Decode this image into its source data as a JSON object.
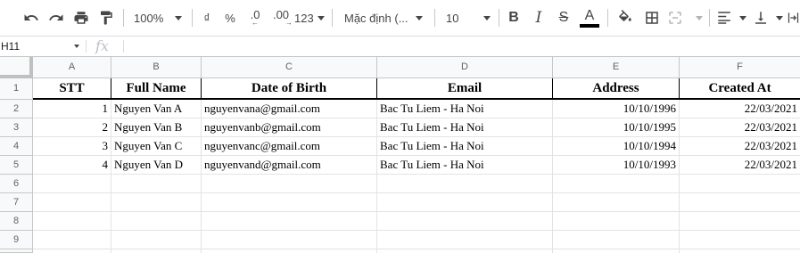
{
  "toolbar": {
    "zoom": "100%",
    "currency_symbol": "₫",
    "percent_symbol": "%",
    "decrease_decimal": ".0",
    "increase_decimal": ".00",
    "number_format": "123",
    "font_name": "Mặc định (...",
    "font_size": "10",
    "bold": "B",
    "italic": "I",
    "strikethrough": "S",
    "text_color_letter": "A",
    "text_color": "#000000"
  },
  "formula_bar": {
    "cell_reference": "H11",
    "fx_label": "fx",
    "formula": ""
  },
  "sheet": {
    "column_letters": [
      "A",
      "B",
      "C",
      "D",
      "E",
      "F"
    ],
    "row_numbers": [
      "1",
      "2",
      "3",
      "4",
      "5",
      "6",
      "7",
      "8",
      "9"
    ],
    "header_row": [
      "STT",
      "Full Name",
      "Date of Birth",
      "Email",
      "Address",
      "Created At"
    ],
    "rows": [
      [
        "1",
        "Nguyen Van A",
        "nguyenvana@gmail.com",
        "Bac Tu Liem - Ha Noi",
        "10/10/1996",
        "22/03/2021"
      ],
      [
        "2",
        "Nguyen Van B",
        "nguyenvanb@gmail.com",
        "Bac Tu Liem - Ha Noi",
        "10/10/1995",
        "22/03/2021"
      ],
      [
        "3",
        "Nguyen Van C",
        "nguyenvanc@gmail.com",
        "Bac Tu Liem - Ha Noi",
        "10/10/1994",
        "22/03/2021"
      ],
      [
        "4",
        "Nguyen Van D",
        "nguyenvand@gmail.com",
        "Bac Tu Liem - Ha Noi",
        "10/10/1993",
        "22/03/2021"
      ]
    ]
  }
}
